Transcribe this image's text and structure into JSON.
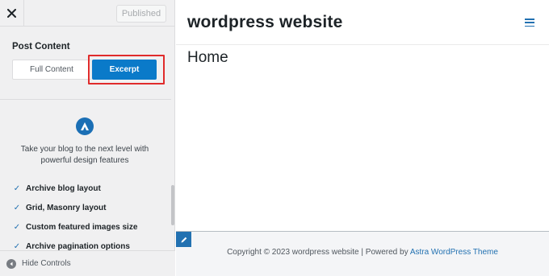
{
  "sidebar": {
    "published_label": "Published",
    "section_title": "Post Content",
    "option_full": "Full Content",
    "option_excerpt": "Excerpt",
    "promo_text": "Take your blog to the next level with powerful design features",
    "features": [
      "Archive blog layout",
      "Grid, Masonry layout",
      "Custom featured images size",
      "Archive pagination options"
    ],
    "hide_controls": "Hide Controls"
  },
  "preview": {
    "site_title": "wordpress website",
    "page_heading": "Home",
    "footer_prefix": "Copyright © 2023 wordpress website | Powered by ",
    "footer_link": "Astra WordPress Theme"
  },
  "colors": {
    "accent": "#0a7ac9",
    "highlight": "#e02b2b",
    "link": "#2271b1"
  },
  "icons": [
    "close-icon",
    "astra-logo-icon",
    "checkmark-icon",
    "arrow-left-icon",
    "hamburger-menu-icon",
    "pencil-icon"
  ]
}
